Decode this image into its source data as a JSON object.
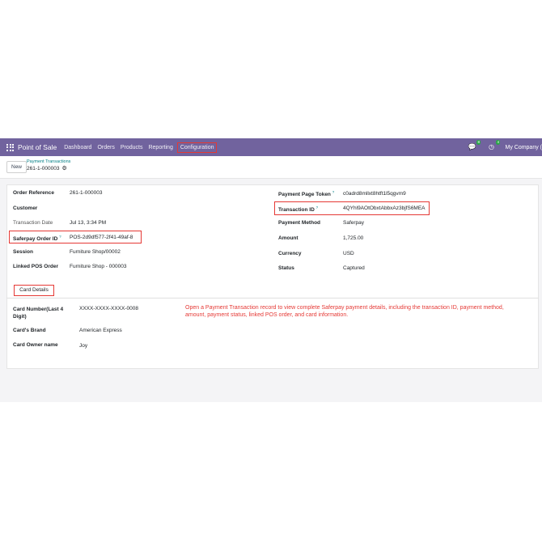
{
  "navbar": {
    "app_name": "Point of Sale",
    "menu": [
      "Dashboard",
      "Orders",
      "Products",
      "Reporting",
      "Configuration"
    ],
    "chat_badge": "8",
    "activity_badge": "4",
    "company": "My Company ("
  },
  "control_panel": {
    "new_label": "New",
    "breadcrumb": "Payment Transactions",
    "record_name": "261-1-000003"
  },
  "form": {
    "left": [
      {
        "label": "Order Reference",
        "value": "261-1-000003"
      },
      {
        "label": "Customer",
        "value": ""
      },
      {
        "label": "Transaction Date",
        "value": "Jul 13, 3:34 PM"
      },
      {
        "label": "Saferpay Order ID",
        "value": "POS-2d9df577-2f41-49af-8"
      },
      {
        "label": "Session",
        "value": "Furniture Shop/00002"
      },
      {
        "label": "Linked POS Order",
        "value": "Furniture Shop - 000003"
      }
    ],
    "right": [
      {
        "label": "Payment Page Token",
        "value": "c0adrd8mllxt8htft1l5qgvm9"
      },
      {
        "label": "Transaction ID",
        "value": "4QYhl9AOtObxtAbbxAz3bjfS6MEA"
      },
      {
        "label": "Payment Method",
        "value": "Saferpay"
      },
      {
        "label": "Amount",
        "value": "1,725.00"
      },
      {
        "label": "Currency",
        "value": "USD"
      },
      {
        "label": "Status",
        "value": "Captured"
      }
    ],
    "help_mark": "?",
    "tab_label": "Card Details",
    "card": [
      {
        "label": "Card Number(Last 4 Digit)",
        "value": "XXXX-XXXX-XXXX-0008"
      },
      {
        "label": "Card's Brand",
        "value": "American Express"
      },
      {
        "label": "Card Owner name",
        "value": "Joy"
      }
    ]
  },
  "annotation": "Open a Payment Transaction record to view complete Saferpay payment details, including the transaction ID, payment method, amount, payment status, linked POS order, and card information."
}
